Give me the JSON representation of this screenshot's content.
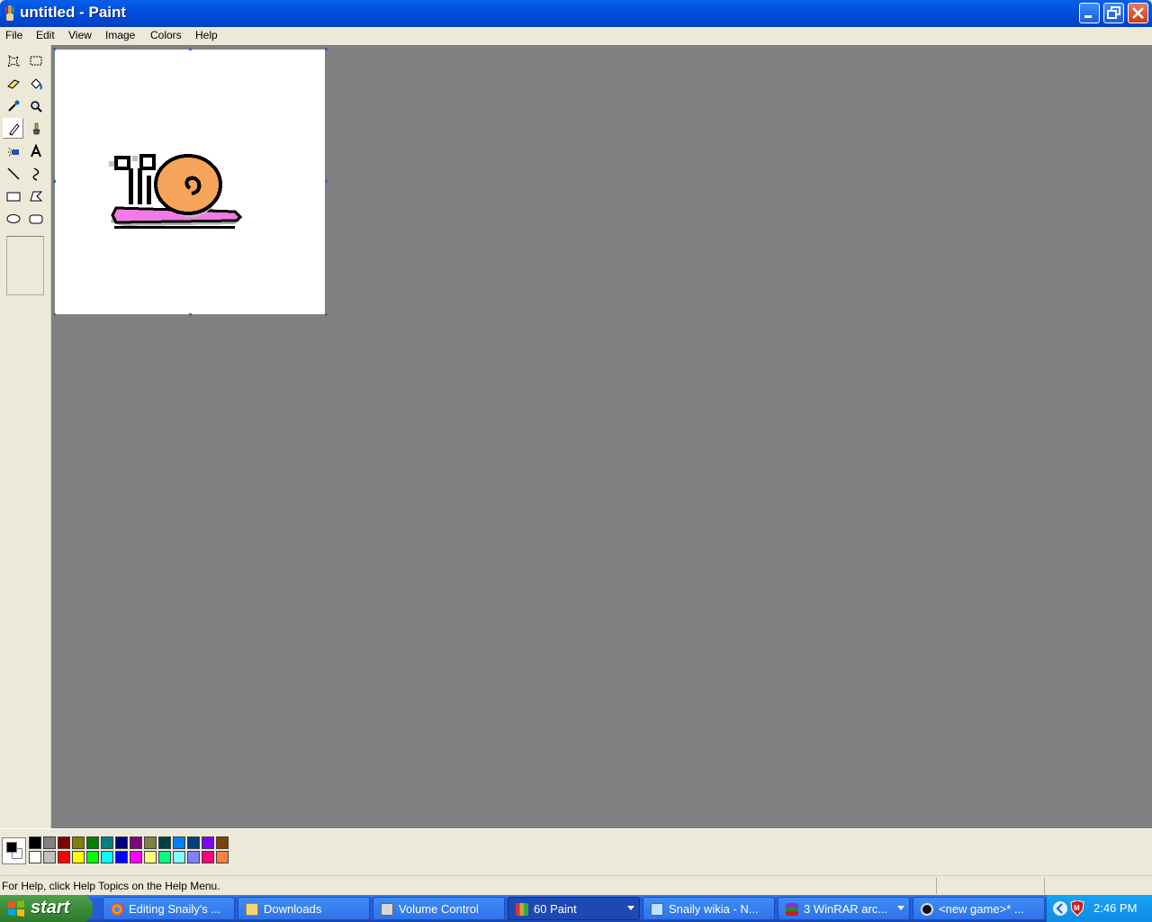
{
  "window": {
    "title": "untitled - Paint"
  },
  "menu": [
    "File",
    "Edit",
    "View",
    "Image",
    "Colors",
    "Help"
  ],
  "tools": [
    "free-form-select-icon",
    "select-icon",
    "eraser-icon",
    "fill-icon",
    "pick-color-icon",
    "magnifier-icon",
    "pencil-icon",
    "brush-icon",
    "airbrush-icon",
    "text-icon",
    "line-icon",
    "curve-icon",
    "rectangle-icon",
    "polygon-icon",
    "ellipse-icon",
    "rounded-rectangle-icon"
  ],
  "active_tool": "pencil-icon",
  "palette": {
    "foreground": "#000000",
    "background": "#ffffff",
    "top": [
      "#000000",
      "#808080",
      "#800000",
      "#808000",
      "#008000",
      "#008080",
      "#000080",
      "#800080",
      "#808040",
      "#004040",
      "#0080ff",
      "#004080",
      "#8000ff",
      "#804000"
    ],
    "bottom": [
      "#ffffff",
      "#c0c0c0",
      "#ff0000",
      "#ffff00",
      "#00ff00",
      "#00ffff",
      "#0000ff",
      "#ff00ff",
      "#ffff80",
      "#00ff80",
      "#80ffff",
      "#8080ff",
      "#ff0080",
      "#ff8040"
    ]
  },
  "status": {
    "text": "For Help, click Help Topics on the Help Menu."
  },
  "taskbar": {
    "start_label": "start",
    "tasks": [
      {
        "label": "Editing Snaily's ...",
        "icon": "chrome-icon"
      },
      {
        "label": "Downloads",
        "icon": "folder-icon"
      },
      {
        "label": "Volume Control",
        "icon": "volume-control-icon"
      },
      {
        "label": "60 Paint",
        "icon": "paint-icon"
      },
      {
        "label": "Snaily wikia - N...",
        "icon": "notepad-icon"
      },
      {
        "label": "3 WinRAR arc...",
        "icon": "winrar-icon"
      },
      {
        "label": "<new game>* ...",
        "icon": "game-maker-icon"
      }
    ],
    "clock": "2:46 PM"
  }
}
